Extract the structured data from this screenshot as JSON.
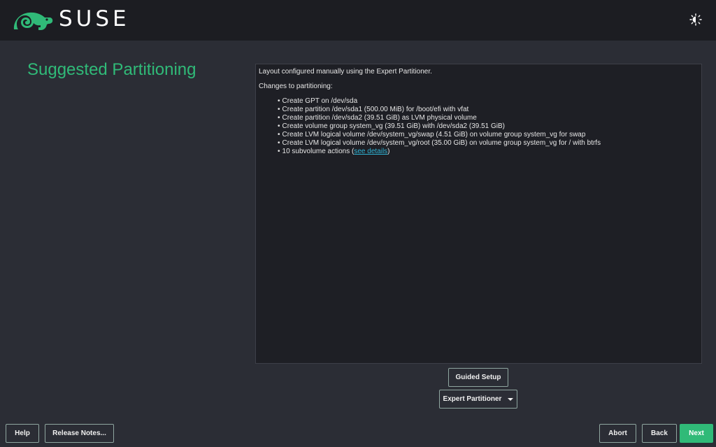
{
  "header": {
    "brand": "SUSE",
    "logo_icon": "suse-chameleon-icon",
    "theme_icon": "theme-toggle-icon"
  },
  "page": {
    "title": "Suggested Partitioning"
  },
  "summary": {
    "intro": "Layout configured manually using the Expert Partitioner.",
    "changes_heading": "Changes to partitioning:",
    "items": [
      "Create GPT on /dev/sda",
      "Create partition /dev/sda1 (500.00 MiB) for /boot/efi with vfat",
      "Create partition /dev/sda2 (39.51 GiB) as LVM physical volume",
      "Create volume group system_vg (39.51 GiB) with /dev/sda2 (39.51 GiB)",
      "Create LVM logical volume /dev/system_vg/swap (4.51 GiB) on volume group system_vg for swap",
      "Create LVM logical volume /dev/system_vg/root (35.00 GiB) on volume group system_vg for / with btrfs"
    ],
    "subvolume_prefix": "10 subvolume actions (",
    "subvolume_link": "see details",
    "subvolume_suffix": ")"
  },
  "actions": {
    "guided_setup": "Guided Setup",
    "expert_partitioner": "Expert Partitioner"
  },
  "footer": {
    "help": "Help",
    "release_notes": "Release Notes...",
    "abort": "Abort",
    "back": "Back",
    "next": "Next"
  },
  "colors": {
    "accent": "#30ba78",
    "background": "#2b2d35",
    "header": "#1c1d22",
    "link": "#2fb3d5"
  }
}
